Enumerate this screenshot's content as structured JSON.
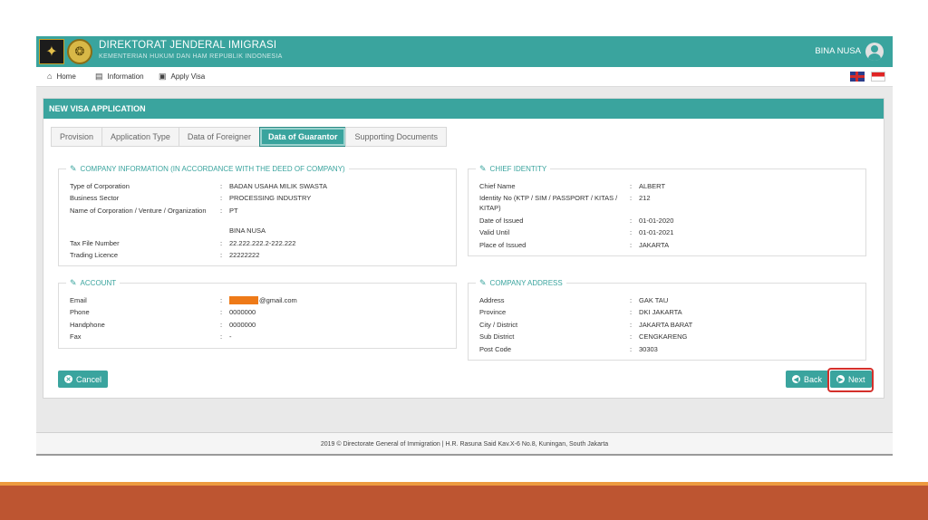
{
  "header": {
    "org_title": "DIREKTORAT JENDERAL IMIGRASI",
    "org_subtitle": "KEMENTERIAN HUKUM DAN HAM REPUBLIK INDONESIA",
    "user_name": "BINA NUSA",
    "logo_1": "garuda-emblem-icon",
    "logo_2": "immigration-seal-icon"
  },
  "nav": {
    "items": [
      {
        "label": "Home",
        "icon": "home-icon"
      },
      {
        "label": "Information",
        "icon": "book-icon"
      },
      {
        "label": "Apply Visa",
        "icon": "id-card-icon"
      }
    ],
    "languages": [
      "uk-flag-icon",
      "indonesia-flag-icon"
    ]
  },
  "panel": {
    "title": "NEW VISA APPLICATION",
    "tabs": [
      {
        "label": "Provision",
        "active": false
      },
      {
        "label": "Application Type",
        "active": false
      },
      {
        "label": "Data of Foreigner",
        "active": false
      },
      {
        "label": "Data of Guarantor",
        "active": true
      },
      {
        "label": "Supporting Documents",
        "active": false
      }
    ]
  },
  "company_info": {
    "title": "COMPANY INFORMATION (IN ACCORDANCE WITH THE DEED OF COMPANY)",
    "rows": [
      {
        "label": "Type of Corporation",
        "value": "BADAN USAHA MILIK SWASTA"
      },
      {
        "label": "Business Sector",
        "value": "PROCESSING INDUSTRY"
      },
      {
        "label": "Name of Corporation / Venture / Organization",
        "value": "PT"
      },
      {
        "label": "",
        "value": "BINA NUSA"
      },
      {
        "label": "Tax File Number",
        "value": "22.222.222.2-222.222"
      },
      {
        "label": "Trading Licence",
        "value": "22222222"
      }
    ]
  },
  "chief_identity": {
    "title": "CHIEF IDENTITY",
    "rows": [
      {
        "label": "Chief Name",
        "value": "ALBERT"
      },
      {
        "label": "Identity No (KTP / SIM / PASSPORT / KITAS /",
        "label2": "KITAP)",
        "value": "212"
      },
      {
        "label": "Date of Issued",
        "value": "01-01-2020"
      },
      {
        "label": "Valid Until",
        "value": "01-01-2021"
      },
      {
        "label": "Place of Issued",
        "value": "JAKARTA"
      }
    ]
  },
  "account": {
    "title": "ACCOUNT",
    "rows": [
      {
        "label": "Email",
        "value": "@gmail.com"
      },
      {
        "label": "Phone",
        "value": "0000000"
      },
      {
        "label": "Handphone",
        "value": "0000000"
      },
      {
        "label": "Fax",
        "value": "-"
      }
    ]
  },
  "company_address": {
    "title": "COMPANY ADDRESS",
    "rows": [
      {
        "label": "Address",
        "value": "GAK TAU"
      },
      {
        "label": "Province",
        "value": "DKI JAKARTA"
      },
      {
        "label": "City / District",
        "value": "JAKARTA BARAT"
      },
      {
        "label": "Sub District",
        "value": "CENGKARENG"
      },
      {
        "label": "Post Code",
        "value": "30303"
      }
    ]
  },
  "separator": ":",
  "buttons": {
    "cancel": "Cancel",
    "back": "Back",
    "next": "Next"
  },
  "footer": {
    "text": "2019 © Directorate General of Immigration | H.R. Rasuna Said Kav.X-6 No.8, Kuningan, South Jakarta"
  },
  "colors": {
    "primary": "#3aa49e",
    "highlight": "#d4302b",
    "redaction": "#ee7a18",
    "accent_strip": "#bd5531"
  }
}
